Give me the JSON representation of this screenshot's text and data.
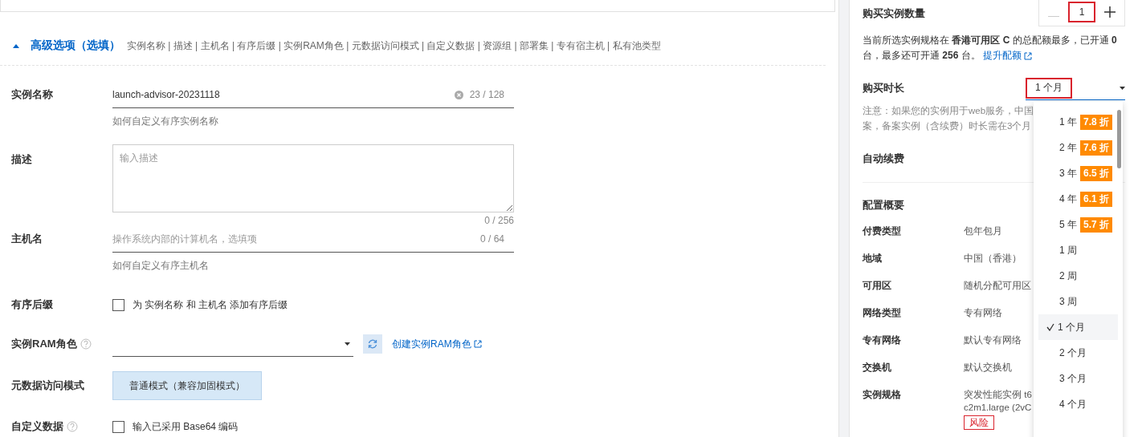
{
  "section": {
    "title": "高级选项（选填）",
    "expanded": true,
    "summary": "实例名称 | 描述 | 主机名 | 有序后缀 | 实例RAM角色 | 元数据访问模式 | 自定义数据 | 资源组 | 部署集 | 专有宿主机 | 私有池类型"
  },
  "fields": [
    {
      "kind": "text",
      "label": "实例名称",
      "value": "launch-advisor-20231118",
      "counter": "23 / 128",
      "hint": "如何自定义有序实例名称"
    },
    {
      "kind": "textarea",
      "label": "描述",
      "placeholder": "输入描述",
      "counter": "0 / 256"
    },
    {
      "kind": "text",
      "label": "主机名",
      "placeholder": "操作系统内部的计算机名，选填项",
      "counter": "0 / 64",
      "hint": "如何自定义有序主机名"
    },
    {
      "kind": "checkbox",
      "label": "有序后缀",
      "text": "为 实例名称 和 主机名 添加有序后缀",
      "checked": false
    },
    {
      "kind": "select",
      "label": "实例RAM角色",
      "help": true,
      "link": "创建实例RAM角色"
    },
    {
      "kind": "mode",
      "label": "元数据访问模式",
      "options": [
        {
          "label": "普通模式（兼容加固模式）",
          "selected": true
        }
      ]
    },
    {
      "kind": "checkbox",
      "label": "自定义数据",
      "help": true,
      "text": "输入已采用 Base64 编码",
      "checked": false
    }
  ],
  "purchase": {
    "quantity_label": "购买实例数量",
    "quantity": "1",
    "quota_note": "当前所选实例规格在 **香港可用区 C** 的总配额最多，已开通 **0** 台，最多还可开通 **256** 台。",
    "quota_link": "提升配额",
    "duration_label": "购买时长",
    "duration": "1 个月",
    "notice": [
      "注意：如果您的实例用于web服务，中国",
      "案，备案实例（含续费）时长需在3个月"
    ],
    "auto_renew_label": "自动续费"
  },
  "summary": {
    "title": "配置概要",
    "rows": [
      {
        "label": "付费类型",
        "value": [
          "包年包月"
        ]
      },
      {
        "label": "地域",
        "value": [
          "中国（香港）"
        ]
      },
      {
        "label": "可用区",
        "value": [
          "随机分配可用区"
        ]
      },
      {
        "label": "网络类型",
        "value": [
          "专有网络"
        ]
      },
      {
        "label": "专有网络",
        "value": [
          "默认专有网络"
        ]
      },
      {
        "label": "交换机",
        "value": [
          "默认交换机"
        ]
      },
      {
        "label": "实例规格",
        "value": [
          "突发性能实例 t6",
          "c2m1.large (2vC"
        ],
        "tag": "风险"
      }
    ]
  },
  "duration_menu": [
    {
      "label": "1 年",
      "discount": "7.8 折",
      "selected": false
    },
    {
      "label": "2 年",
      "discount": "7.6 折",
      "selected": false
    },
    {
      "label": "3 年",
      "discount": "6.5 折",
      "selected": false
    },
    {
      "label": "4 年",
      "discount": "6.1 折",
      "selected": false
    },
    {
      "label": "5 年",
      "discount": "5.7 折",
      "selected": false
    },
    {
      "label": "1 周",
      "selected": false
    },
    {
      "label": "2 周",
      "selected": false
    },
    {
      "label": "3 周",
      "selected": false
    },
    {
      "label": "1 个月",
      "selected": true
    },
    {
      "label": "2 个月",
      "selected": false
    },
    {
      "label": "3 个月",
      "selected": false
    },
    {
      "label": "4 个月",
      "selected": false
    }
  ]
}
